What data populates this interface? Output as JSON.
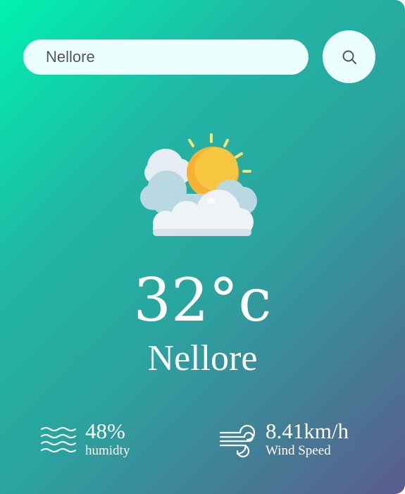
{
  "search": {
    "value": "Nellore",
    "icon": "search-icon"
  },
  "weather": {
    "icon": "partly-cloudy-icon",
    "temperature": "32°c",
    "city": "Nellore"
  },
  "humidity": {
    "icon": "humidity-waves-icon",
    "value": "48%",
    "label": "humidty"
  },
  "wind": {
    "icon": "wind-icon",
    "value": "8.41km/h",
    "label": "Wind Speed"
  },
  "colors": {
    "gradient_start": "#00f2b0",
    "gradient_mid": "#2aa49f",
    "gradient_end": "#5b5b8c",
    "search_bg": "#ebfffc",
    "sun": "#f7c641",
    "text": "#ffffff"
  }
}
